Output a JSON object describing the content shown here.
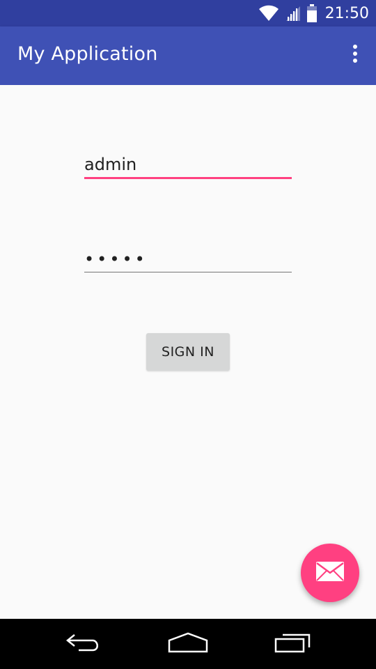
{
  "status_bar": {
    "time": "21:50",
    "icons": [
      "wifi-icon",
      "cell-signal-icon",
      "battery-icon"
    ],
    "background": "#303f9f"
  },
  "app_bar": {
    "title": "My Application",
    "overflow_icon": "more-vert-icon",
    "background": "#3f51b5"
  },
  "form": {
    "username_value": "admin",
    "password_value": "•••••",
    "sign_in_label": "SIGN IN",
    "accent_color": "#ff4081"
  },
  "fab": {
    "icon": "email-icon",
    "color": "#ff4081"
  },
  "navigation_bar": {
    "buttons": [
      "back-icon",
      "home-icon",
      "recents-icon"
    ]
  }
}
